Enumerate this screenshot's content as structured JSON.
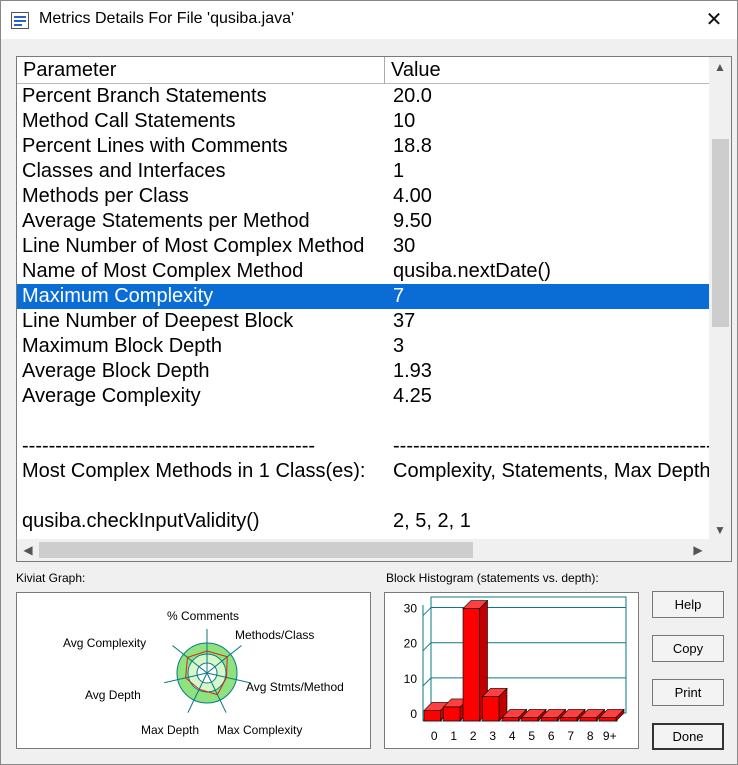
{
  "window": {
    "title": "Metrics Details For File 'qusiba.java'",
    "close_glyph": "✕"
  },
  "table": {
    "headers": {
      "parameter": "Parameter",
      "value": "Value"
    },
    "rows": [
      {
        "param": "Percent Branch Statements",
        "value": "20.0"
      },
      {
        "param": "Method Call Statements",
        "value": "10"
      },
      {
        "param": "Percent Lines with Comments",
        "value": "18.8"
      },
      {
        "param": "Classes and Interfaces",
        "value": "1"
      },
      {
        "param": "Methods per Class",
        "value": "4.00"
      },
      {
        "param": "Average Statements per Method",
        "value": "9.50"
      },
      {
        "param": "Line Number of Most Complex Method",
        "value": "30"
      },
      {
        "param": "Name of Most Complex Method",
        "value": "qusiba.nextDate()"
      },
      {
        "param": "Maximum Complexity",
        "value": "7"
      },
      {
        "param": "Line Number of Deepest Block",
        "value": "37"
      },
      {
        "param": "Maximum Block Depth",
        "value": "3"
      },
      {
        "param": "Average Block Depth",
        "value": "1.93"
      },
      {
        "param": "Average Complexity",
        "value": "4.25"
      },
      {
        "param": "",
        "value": ""
      },
      {
        "param": "--------------------------------------------",
        "value": "------------------------------------------------"
      },
      {
        "param": "Most Complex Methods in 1 Class(es):",
        "value": "Complexity, Statements, Max Depth, Calls"
      },
      {
        "param": "",
        "value": ""
      },
      {
        "param": "qusiba.checkInputValidity()",
        "value": "2, 5, 2, 1"
      }
    ],
    "selected_row": 8
  },
  "kiviat": {
    "label": "Kiviat Graph:",
    "axes": [
      "% Comments",
      "Methods/Class",
      "Avg Stmts/Method",
      "Max Complexity",
      "Max Depth",
      "Avg Depth",
      "Avg Complexity"
    ],
    "colors": {
      "outer_ring": "#8fe37f",
      "inner_ring": "#d6f7c9",
      "spokes": "#0a7b83",
      "value_line": "#e02020"
    }
  },
  "histogram": {
    "label": "Block Histogram (statements vs. depth):",
    "y_ticks": [
      "0",
      "10",
      "20",
      "30"
    ],
    "categories": [
      "0",
      "1",
      "2",
      "3",
      "4",
      "5",
      "6",
      "7",
      "8",
      "9+"
    ],
    "values": [
      3,
      4,
      32,
      7,
      1,
      1,
      1,
      1,
      1,
      1
    ],
    "ymax": 32,
    "bar_color": "#ff0000",
    "grid_color": "#0a7b83"
  },
  "buttons": {
    "help": "Help",
    "copy": "Copy",
    "print": "Print",
    "done": "Done"
  }
}
